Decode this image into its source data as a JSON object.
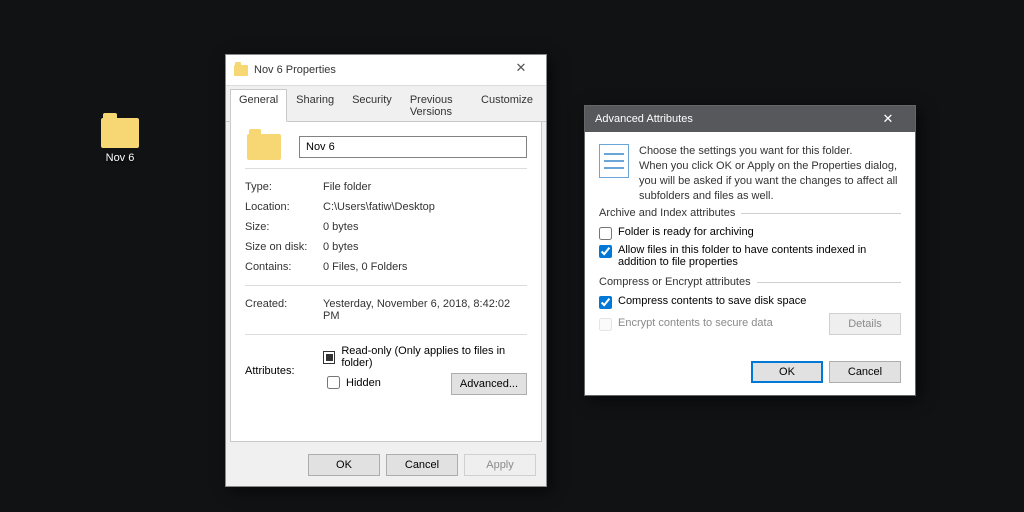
{
  "desktop": {
    "folder_label": "Nov 6"
  },
  "props": {
    "title": "Nov 6 Properties",
    "tabs": {
      "general": "General",
      "sharing": "Sharing",
      "security": "Security",
      "previous": "Previous Versions",
      "customize": "Customize"
    },
    "name_value": "Nov 6",
    "type_label": "Type:",
    "type_value": "File folder",
    "location_label": "Location:",
    "location_value": "C:\\Users\\fatiw\\Desktop",
    "size_label": "Size:",
    "size_value": "0 bytes",
    "size_on_disk_label": "Size on disk:",
    "size_on_disk_value": "0 bytes",
    "contains_label": "Contains:",
    "contains_value": "0 Files, 0 Folders",
    "created_label": "Created:",
    "created_value": "Yesterday, November 6, 2018, 8:42:02 PM",
    "attributes_label": "Attributes:",
    "readonly_label": "Read-only (Only applies to files in folder)",
    "hidden_label": "Hidden",
    "advanced_btn": "Advanced...",
    "ok": "OK",
    "cancel": "Cancel",
    "apply": "Apply"
  },
  "adv": {
    "title": "Advanced Attributes",
    "intro1": "Choose the settings you want for this folder.",
    "intro2": "When you click OK or Apply on the Properties dialog, you will be asked if you want the changes to affect all subfolders and files as well.",
    "archive_group": "Archive and Index attributes",
    "archive_ready": "Folder is ready for archiving",
    "index_allow": "Allow files in this folder to have contents indexed in addition to file properties",
    "compress_group": "Compress or Encrypt attributes",
    "compress_label": "Compress contents to save disk space",
    "encrypt_label": "Encrypt contents to secure data",
    "details_btn": "Details",
    "ok": "OK",
    "cancel": "Cancel"
  }
}
